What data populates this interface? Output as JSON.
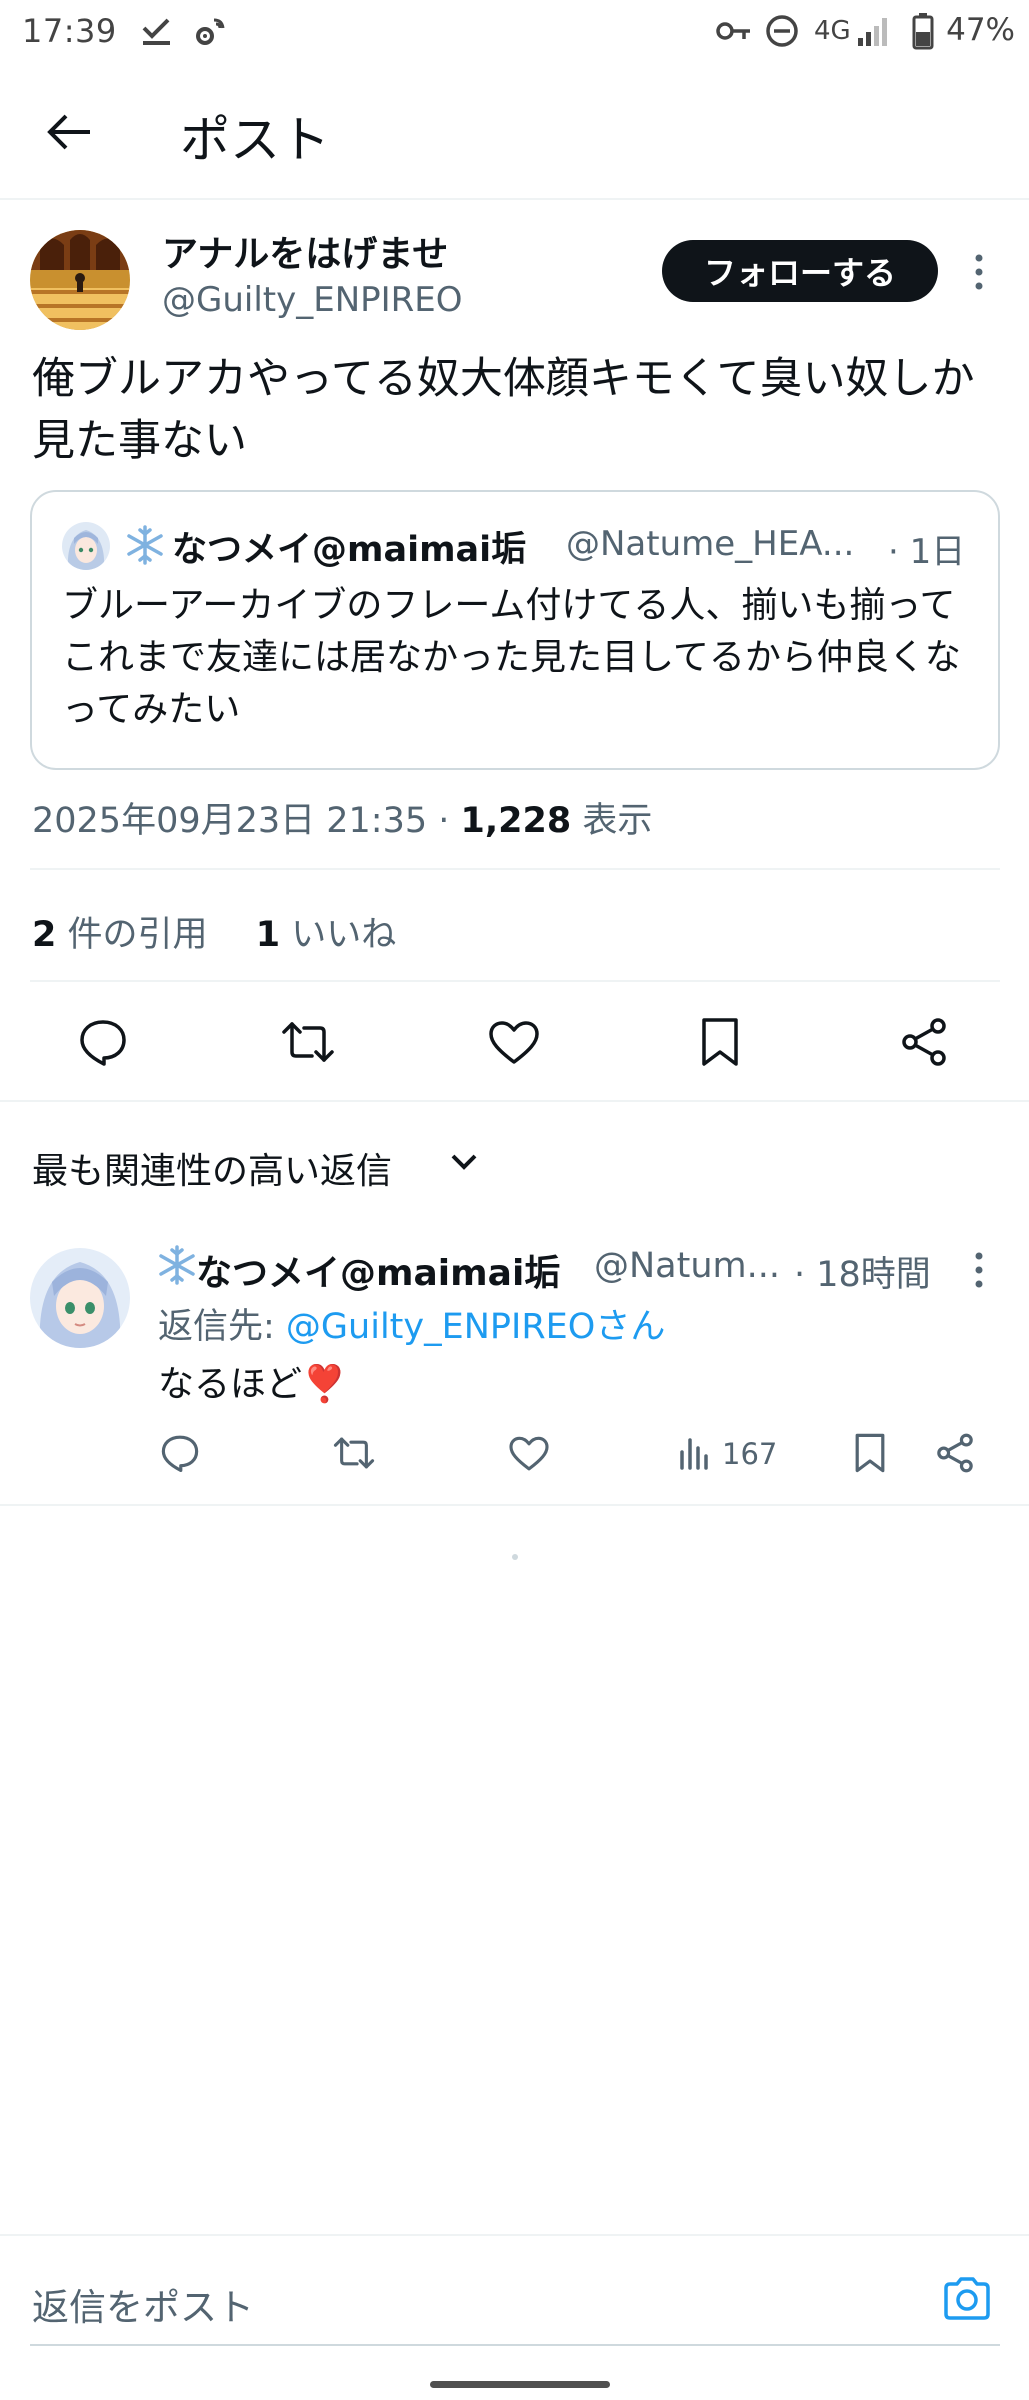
{
  "status_bar": {
    "time": "17:39",
    "network": "4G",
    "battery": "47%"
  },
  "header": {
    "title": "ポスト"
  },
  "post": {
    "author_name": "アナルをはげませ",
    "author_handle": "@Guilty_ENPIREO",
    "follow_label": "フォローする",
    "text": "俺ブルアカやってる奴大体顔キモくて臭い奴しか見た事ない",
    "quote": {
      "name": "なつメイ@maimai垢",
      "handle": "@Natume_HEA...",
      "time": "· 1日",
      "text": "ブルーアーカイブのフレーム付けてる人、揃いも揃ってこれまで友達には居なかった見た目してるから仲良くなってみたい"
    },
    "timestamp": "2025年09月23日 21:35 · ",
    "views_count": "1,228",
    "views_label": " 表示",
    "quotes_count": "2",
    "quotes_label": " 件の引用",
    "likes_count": "1",
    "likes_label": " いいね"
  },
  "replies_sort": {
    "label": "最も関連性の高い返信"
  },
  "reply": {
    "name": "なつメイ@maimai垢",
    "handle": "@Natum...",
    "time": "· 18時間",
    "replying_to_label": "返信先: ",
    "replying_to_mention": "@Guilty_ENPIREOさん",
    "text": "なるほど❣️",
    "views": "167"
  },
  "compose": {
    "placeholder": "返信をポスト"
  },
  "colors": {
    "accent": "#1d9bf0",
    "text_primary": "#0f1419",
    "text_secondary": "#536471",
    "border": "#cfd9de",
    "follow_bg": "#0f1419"
  }
}
